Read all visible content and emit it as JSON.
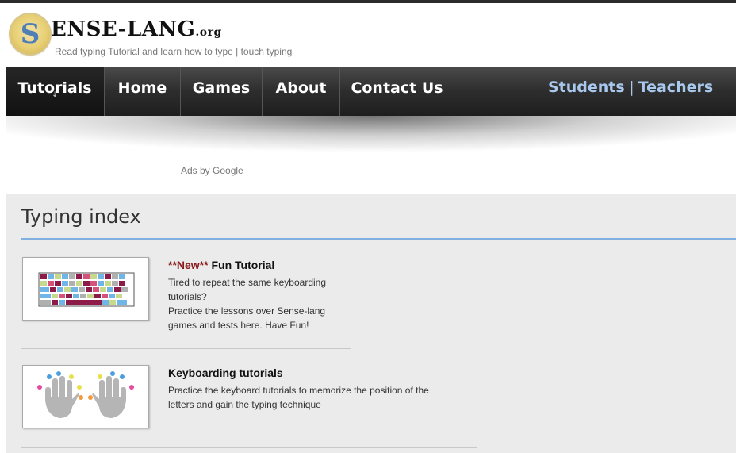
{
  "brand": {
    "logo_letter": "S",
    "name": "ENSE-LANG",
    "tld": ".org",
    "tagline": "Read typing Tutorial and learn how to type | touch typing"
  },
  "nav": {
    "items": [
      {
        "label": "Tutorials",
        "active": true,
        "indicator": "⇣"
      },
      {
        "label": "Home"
      },
      {
        "label": "Games"
      },
      {
        "label": "About"
      },
      {
        "label": "Contact Us"
      }
    ],
    "right": {
      "students": "Students",
      "separator": "|",
      "teachers": "Teachers"
    }
  },
  "ads_label": "Ads by Google",
  "main": {
    "title": "Typing index",
    "items": [
      {
        "badge": "**New**",
        "title": "Fun Tutorial",
        "lines": [
          "Tired to repeat the same keyboarding",
          "tutorials?",
          "Practice the lessons over Sense-lang",
          "games and tests here. Have Fun!"
        ],
        "thumb": "keyboard-image"
      },
      {
        "title": "Keyboarding tutorials",
        "lines": [
          "Practice the keyboard tutorials to memorize the position of the",
          "letters and gain the typing technique"
        ],
        "thumb": "hands-image"
      }
    ]
  },
  "colors": {
    "nav_bg": "#2d2d2d",
    "nav_link_right": "#a8c8ee",
    "content_bg": "#ebebeb",
    "title_rule": "#7fb0e0",
    "new_badge": "#8b1a1a",
    "key_palette": [
      "#8c1b4a",
      "#6fb6e6",
      "#c7d98a",
      "#b0b0b0",
      "#d4527c"
    ],
    "finger_palette": [
      "#4a9fe0",
      "#e8e04a",
      "#f19a3e",
      "#e64aa0"
    ]
  }
}
